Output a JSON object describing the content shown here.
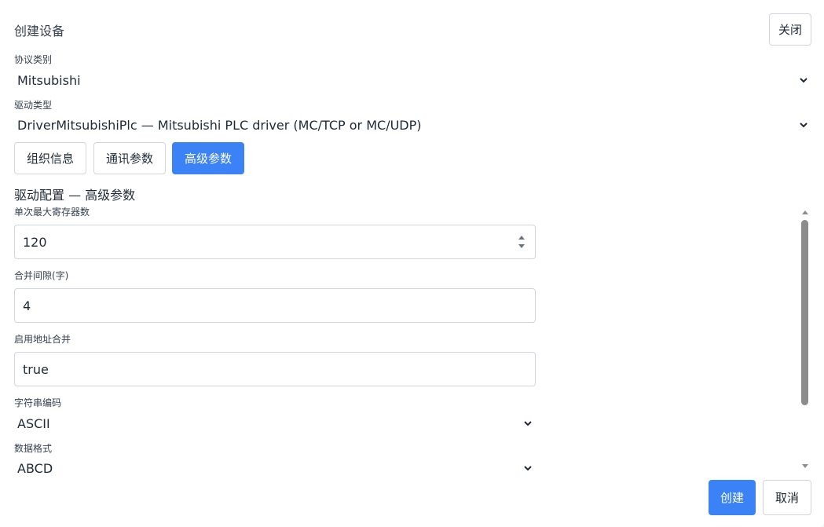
{
  "dialog": {
    "title": "创建设备",
    "close_label": "关闭"
  },
  "protocol": {
    "label": "协议类别",
    "value": "Mitsubishi"
  },
  "driver": {
    "label": "驱动类型",
    "value": "DriverMitsubishiPlc — Mitsubishi PLC driver (MC/TCP or MC/UDP)"
  },
  "tabs": [
    {
      "label": "组织信息",
      "active": false
    },
    {
      "label": "通讯参数",
      "active": false
    },
    {
      "label": "高级参数",
      "active": true
    }
  ],
  "section": {
    "title": "驱动配置 — 高级参数"
  },
  "fields": {
    "max_registers": {
      "label": "单次最大寄存器数",
      "value": "120"
    },
    "merge_gap": {
      "label": "合并间隙(字)",
      "value": "4"
    },
    "enable_merge": {
      "label": "启用地址合并",
      "value": "true"
    },
    "string_encoding": {
      "label": "字符串编码",
      "value": "ASCII"
    },
    "data_format": {
      "label": "数据格式",
      "value": "ABCD"
    }
  },
  "footer": {
    "create_label": "创建",
    "cancel_label": "取消"
  },
  "colors": {
    "primary": "#3b82f6",
    "border": "#d1d5db",
    "scroll_thumb": "#8c8c8c"
  }
}
